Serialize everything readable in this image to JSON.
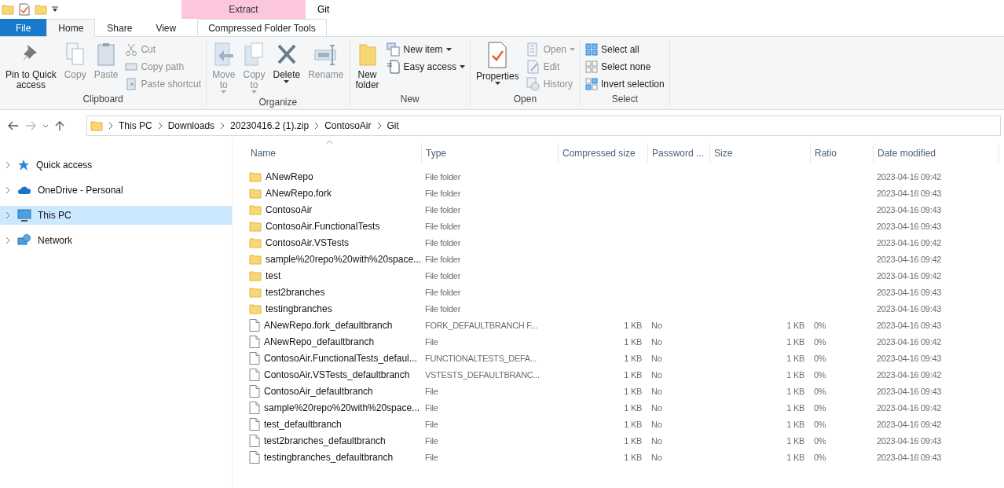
{
  "title_bar": {
    "context_label": "Extract",
    "title": "Git"
  },
  "tabs": [
    {
      "label": "File",
      "kind": "file",
      "selected": false
    },
    {
      "label": "Home",
      "kind": "tab",
      "selected": true
    },
    {
      "label": "Share",
      "kind": "tab",
      "selected": false
    },
    {
      "label": "View",
      "kind": "tab",
      "selected": false
    },
    {
      "label": "Compressed Folder Tools",
      "kind": "context",
      "selected": false
    }
  ],
  "ribbon": {
    "groups": [
      {
        "label": "Clipboard",
        "items": [
          {
            "kind": "large",
            "label": "Pin to Quick\naccess",
            "disabled": false,
            "dropdown": false
          },
          {
            "kind": "large",
            "label": "Copy",
            "disabled": true,
            "dropdown": false
          },
          {
            "kind": "large",
            "label": "Paste",
            "disabled": true,
            "dropdown": false
          },
          {
            "kind": "small",
            "label": "Cut",
            "disabled": true,
            "dropdown": false
          },
          {
            "kind": "small",
            "label": "Copy path",
            "disabled": true,
            "dropdown": false
          },
          {
            "kind": "small",
            "label": "Paste shortcut",
            "disabled": true,
            "dropdown": false
          }
        ]
      },
      {
        "label": "Organize",
        "items": [
          {
            "kind": "large",
            "label": "Move\nto",
            "disabled": true,
            "dropdown": true
          },
          {
            "kind": "large",
            "label": "Copy\nto",
            "disabled": true,
            "dropdown": true
          },
          {
            "kind": "large",
            "label": "Delete",
            "disabled": false,
            "dropdown": true
          },
          {
            "kind": "large",
            "label": "Rename",
            "disabled": true,
            "dropdown": false
          }
        ]
      },
      {
        "label": "New",
        "items": [
          {
            "kind": "large",
            "label": "New\nfolder",
            "disabled": false,
            "dropdown": false
          },
          {
            "kind": "small",
            "label": "New item",
            "disabled": false,
            "dropdown": true
          },
          {
            "kind": "small",
            "label": "Easy access",
            "disabled": false,
            "dropdown": true
          }
        ]
      },
      {
        "label": "Open",
        "items": [
          {
            "kind": "large",
            "label": "Properties",
            "disabled": false,
            "dropdown": true
          },
          {
            "kind": "small",
            "label": "Open",
            "disabled": true,
            "dropdown": true
          },
          {
            "kind": "small",
            "label": "Edit",
            "disabled": true,
            "dropdown": false
          },
          {
            "kind": "small",
            "label": "History",
            "disabled": true,
            "dropdown": false
          }
        ]
      },
      {
        "label": "Select",
        "items": [
          {
            "kind": "small",
            "label": "Select all",
            "disabled": false,
            "dropdown": false
          },
          {
            "kind": "small",
            "label": "Select none",
            "disabled": false,
            "dropdown": false
          },
          {
            "kind": "small",
            "label": "Invert selection",
            "disabled": false,
            "dropdown": false
          }
        ]
      }
    ]
  },
  "address_bar": {
    "path": [
      "This PC",
      "Downloads",
      "20230416.2 (1).zip",
      "ContosoAir",
      "Git"
    ]
  },
  "nav_pane": {
    "items": [
      {
        "label": "Quick access",
        "selected": false
      },
      {
        "label": "OneDrive - Personal",
        "selected": false
      },
      {
        "label": "This PC",
        "selected": true
      },
      {
        "label": "Network",
        "selected": false
      }
    ]
  },
  "table": {
    "columns": [
      "Name",
      "Type",
      "Compressed size",
      "Password ...",
      "Size",
      "Ratio",
      "Date modified"
    ],
    "rows": [
      {
        "kind": "folder",
        "name": "ANewRepo",
        "type": "File folder",
        "date": "2023-04-16 09:42"
      },
      {
        "kind": "folder",
        "name": "ANewRepo.fork",
        "type": "File folder",
        "date": "2023-04-16 09:43"
      },
      {
        "kind": "folder",
        "name": "ContosoAir",
        "type": "File folder",
        "date": "2023-04-16 09:43"
      },
      {
        "kind": "folder",
        "name": "ContosoAir.FunctionalTests",
        "type": "File folder",
        "date": "2023-04-16 09:43"
      },
      {
        "kind": "folder",
        "name": "ContosoAir.VSTests",
        "type": "File folder",
        "date": "2023-04-16 09:42"
      },
      {
        "kind": "folder",
        "name": "sample%20repo%20with%20space...",
        "type": "File folder",
        "date": "2023-04-16 09:42"
      },
      {
        "kind": "folder",
        "name": "test",
        "type": "File folder",
        "date": "2023-04-16 09:42"
      },
      {
        "kind": "folder",
        "name": "test2branches",
        "type": "File folder",
        "date": "2023-04-16 09:43"
      },
      {
        "kind": "folder",
        "name": "testingbranches",
        "type": "File folder",
        "date": "2023-04-16 09:43"
      },
      {
        "kind": "file",
        "name": "ANewRepo.fork_defaultbranch",
        "type": "FORK_DEFAULTBRANCH F...",
        "compressed_size": "1 KB",
        "password": "No",
        "size": "1 KB",
        "ratio": "0%",
        "date": "2023-04-16 09:43"
      },
      {
        "kind": "file",
        "name": "ANewRepo_defaultbranch",
        "type": "File",
        "compressed_size": "1 KB",
        "password": "No",
        "size": "1 KB",
        "ratio": "0%",
        "date": "2023-04-16 09:42"
      },
      {
        "kind": "file",
        "name": "ContosoAir.FunctionalTests_defaul...",
        "type": "FUNCTIONALTESTS_DEFA...",
        "compressed_size": "1 KB",
        "password": "No",
        "size": "1 KB",
        "ratio": "0%",
        "date": "2023-04-16 09:43"
      },
      {
        "kind": "file",
        "name": "ContosoAir.VSTests_defaultbranch",
        "type": "VSTESTS_DEFAULTBRANC...",
        "compressed_size": "1 KB",
        "password": "No",
        "size": "1 KB",
        "ratio": "0%",
        "date": "2023-04-16 09:42"
      },
      {
        "kind": "file",
        "name": "ContosoAir_defaultbranch",
        "type": "File",
        "compressed_size": "1 KB",
        "password": "No",
        "size": "1 KB",
        "ratio": "0%",
        "date": "2023-04-16 09:43"
      },
      {
        "kind": "file",
        "name": "sample%20repo%20with%20space...",
        "type": "File",
        "compressed_size": "1 KB",
        "password": "No",
        "size": "1 KB",
        "ratio": "0%",
        "date": "2023-04-16 09:42"
      },
      {
        "kind": "file",
        "name": "test_defaultbranch",
        "type": "File",
        "compressed_size": "1 KB",
        "password": "No",
        "size": "1 KB",
        "ratio": "0%",
        "date": "2023-04-16 09:42"
      },
      {
        "kind": "file",
        "name": "test2branches_defaultbranch",
        "type": "File",
        "compressed_size": "1 KB",
        "password": "No",
        "size": "1 KB",
        "ratio": "0%",
        "date": "2023-04-16 09:43"
      },
      {
        "kind": "file",
        "name": "testingbranches_defaultbranch",
        "type": "File",
        "compressed_size": "1 KB",
        "password": "No",
        "size": "1 KB",
        "ratio": "0%",
        "date": "2023-04-16 09:43"
      }
    ]
  }
}
